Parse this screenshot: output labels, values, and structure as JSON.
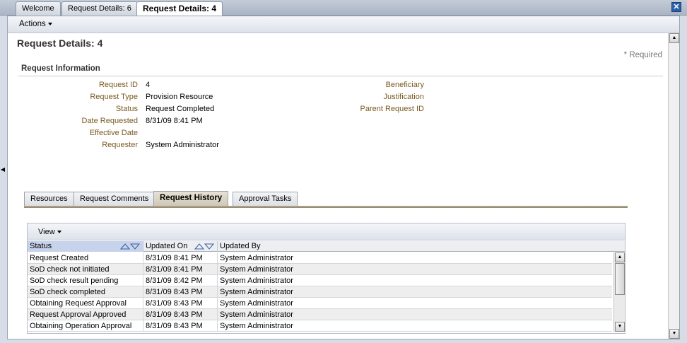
{
  "doc_tabs": [
    "Welcome",
    "Request Details: 6",
    "Request Details: 4"
  ],
  "close_label": "✕",
  "actions": {
    "label": "Actions"
  },
  "page": {
    "title": "Request Details: 4",
    "required_note": "* Required"
  },
  "section": {
    "title": "Request Information"
  },
  "fields_left": [
    {
      "label": "Request ID",
      "value": "4"
    },
    {
      "label": "Request Type",
      "value": "Provision Resource"
    },
    {
      "label": "Status",
      "value": "Request Completed"
    },
    {
      "label": "Date Requested",
      "value": "8/31/09 8:41 PM"
    },
    {
      "label": "Effective Date",
      "value": ""
    },
    {
      "label": "Requester",
      "value": "System Administrator"
    }
  ],
  "fields_right": [
    {
      "label": "Beneficiary",
      "value": ""
    },
    {
      "label": "Justification",
      "value": ""
    },
    {
      "label": "Parent Request ID",
      "value": ""
    }
  ],
  "detail_tabs": [
    "Resources",
    "Request Comments",
    "Request History",
    "Approval Tasks"
  ],
  "detail_tabs_active": "Request History",
  "table": {
    "view_label": "View",
    "columns": [
      "Status",
      "Updated On",
      "Updated By"
    ],
    "rows": [
      [
        "Request Created",
        "8/31/09 8:41 PM",
        "System Administrator"
      ],
      [
        "SoD check not initiated",
        "8/31/09 8:41 PM",
        "System Administrator"
      ],
      [
        "SoD check result pending",
        "8/31/09 8:42 PM",
        "System Administrator"
      ],
      [
        "SoD check completed",
        "8/31/09 8:43 PM",
        "System Administrator"
      ],
      [
        "Obtaining Request Approval",
        "8/31/09 8:43 PM",
        "System Administrator"
      ],
      [
        "Request Approval Approved",
        "8/31/09 8:43 PM",
        "System Administrator"
      ],
      [
        "Obtaining Operation Approval",
        "8/31/09 8:43 PM",
        "System Administrator"
      ]
    ]
  },
  "colors": {
    "label": "#7a5a20",
    "accent": "#2d5fa8",
    "tab_active": "#cfc8b6"
  }
}
